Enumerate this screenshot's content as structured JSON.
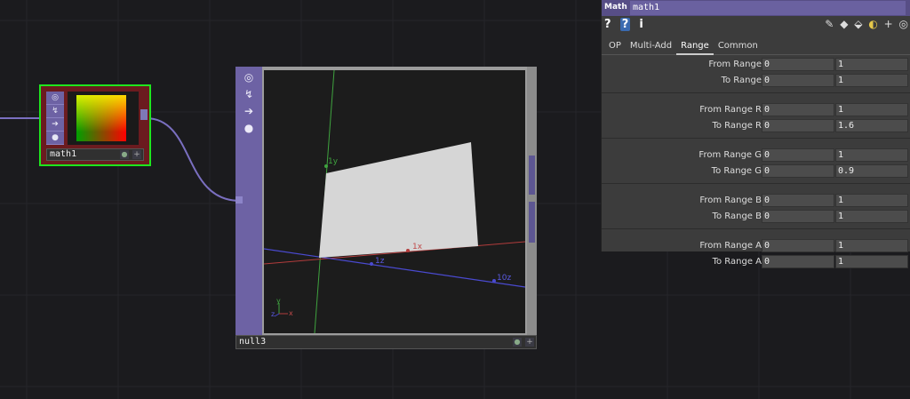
{
  "math1_node": {
    "name": "math1"
  },
  "null3_node": {
    "name": "null3",
    "axis_labels": {
      "y1": "1y",
      "x1": "1x",
      "z1": "1z",
      "z10": "10z",
      "corner_y": "y",
      "corner_x": "x",
      "corner_z": "z"
    }
  },
  "panel": {
    "type": "Math",
    "op_name": "math1",
    "toolbar_left": [
      "?",
      "?",
      "i"
    ],
    "tabs": [
      "OP",
      "Multi-Add",
      "Range",
      "Common"
    ],
    "active_tab": "Range",
    "groups": [
      {
        "rows": [
          {
            "label": "From Range",
            "v1": "0",
            "v2": "1"
          },
          {
            "label": "To Range",
            "v1": "0",
            "v2": "1"
          }
        ]
      },
      {
        "rows": [
          {
            "label": "From Range R",
            "v1": "0",
            "v2": "1"
          },
          {
            "label": "To Range R",
            "v1": "0",
            "v2": "1.6"
          }
        ]
      },
      {
        "rows": [
          {
            "label": "From Range G",
            "v1": "0",
            "v2": "1"
          },
          {
            "label": "To Range G",
            "v1": "0",
            "v2": "0.9"
          }
        ]
      },
      {
        "rows": [
          {
            "label": "From Range B",
            "v1": "0",
            "v2": "1"
          },
          {
            "label": "To Range B",
            "v1": "0",
            "v2": "1"
          }
        ]
      },
      {
        "rows": [
          {
            "label": "From Range A",
            "v1": "0",
            "v2": "1"
          },
          {
            "label": "To Range A",
            "v1": "0",
            "v2": "1"
          }
        ]
      }
    ]
  },
  "colors": {
    "select": "#1ee61e",
    "node_purple": "#6d62a4",
    "wire": "#7a6fc0",
    "axis_y": "#3fa33f",
    "axis_x": "#b23c3c",
    "axis_z": "#4a4ad0"
  }
}
